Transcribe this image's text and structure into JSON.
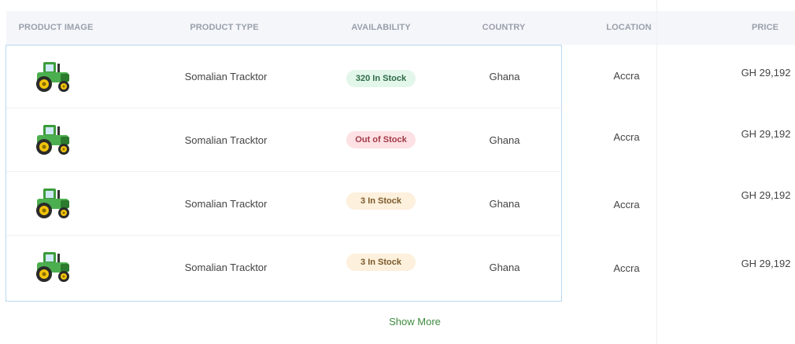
{
  "table": {
    "headers": {
      "image": "PRODUCT IMAGE",
      "type": "PRODUCT TYPE",
      "availability": "AVAILABILITY",
      "country": "COUNTRY",
      "location": "LOCATION",
      "price": "PRICE"
    },
    "rows": [
      {
        "image_icon": "tractor-icon",
        "type": "Somalian Tracktor",
        "availability": "320 In Stock",
        "availability_status": "in-stock",
        "country": "Ghana",
        "location": "Accra",
        "price": "GH 29,192"
      },
      {
        "image_icon": "tractor-icon",
        "type": "Somalian Tracktor",
        "availability": "Out of Stock",
        "availability_status": "out-of-stock",
        "country": "Ghana",
        "location": "Accra",
        "price": "GH 29,192"
      },
      {
        "image_icon": "tractor-icon",
        "type": "Somalian Tracktor",
        "availability": "3 In Stock",
        "availability_status": "low-stock",
        "country": "Ghana",
        "location": "Accra",
        "price": "GH 29,192"
      },
      {
        "image_icon": "tractor-icon",
        "type": "Somalian Tracktor",
        "availability": "3 In Stock",
        "availability_status": "low-stock",
        "country": "Ghana",
        "location": "Accra",
        "price": "GH 29,192"
      }
    ]
  },
  "show_more_label": "Show More",
  "colors": {
    "header_bg": "#f4f6fa",
    "frame_border": "#b9d8f2",
    "link_green": "#3e8a3e",
    "badge_in_stock": "#e2f6ea",
    "badge_out_of_stock": "#fde1e4",
    "badge_low_stock": "#fdf0dc"
  }
}
